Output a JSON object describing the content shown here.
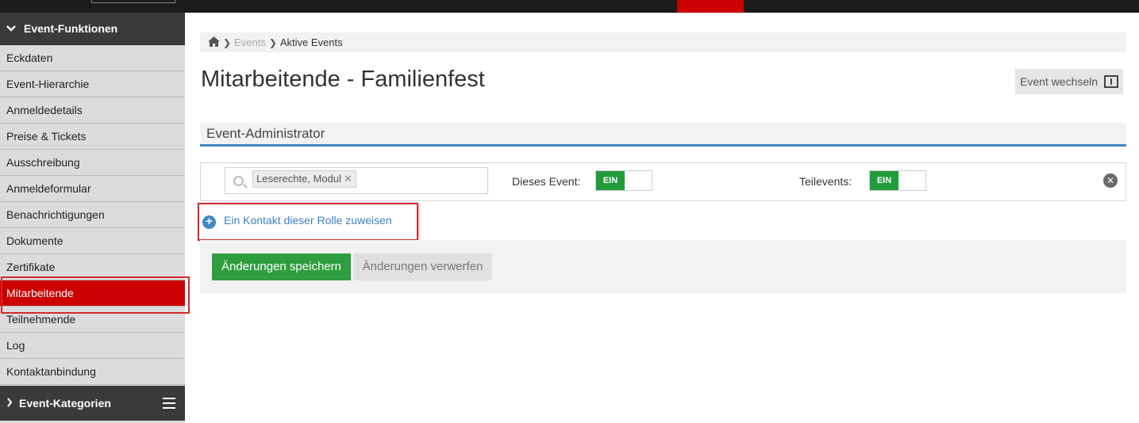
{
  "sidebar": {
    "header": "Event-Funktionen",
    "items": [
      "Eckdaten",
      "Event-Hierarchie",
      "Anmeldedetails",
      "Preise & Tickets",
      "Ausschreibung",
      "Anmeldeformular",
      "Benachrichtigungen",
      "Dokumente",
      "Zertifikate",
      "Mitarbeitende",
      "Teilnehmende",
      "Log",
      "Kontaktanbindung"
    ],
    "active_item": "Mitarbeitende",
    "footer": "Event-Kategorien"
  },
  "breadcrumb": {
    "home_icon": "home-icon",
    "items": [
      "Events",
      "Aktive Events"
    ]
  },
  "page": {
    "title": "Mitarbeitende - Familienfest",
    "switch_button": "Event wechseln"
  },
  "section": {
    "title": "Event-Administrator"
  },
  "role_row": {
    "tag": "Leserechte, Modul",
    "event_label": "Dieses Event:",
    "event_toggle": "EIN",
    "subevents_label": "Teilevents:",
    "subevents_toggle": "EIN"
  },
  "assign_link": "Ein Kontakt dieser Rolle zuweisen",
  "actions": {
    "save": "Änderungen speichern",
    "discard": "Änderungen verwerfen"
  },
  "colors": {
    "accent_red": "#cc0000",
    "link_blue": "#3f88c5",
    "toggle_green": "#219c3b",
    "save_green": "#2e9e3f"
  }
}
